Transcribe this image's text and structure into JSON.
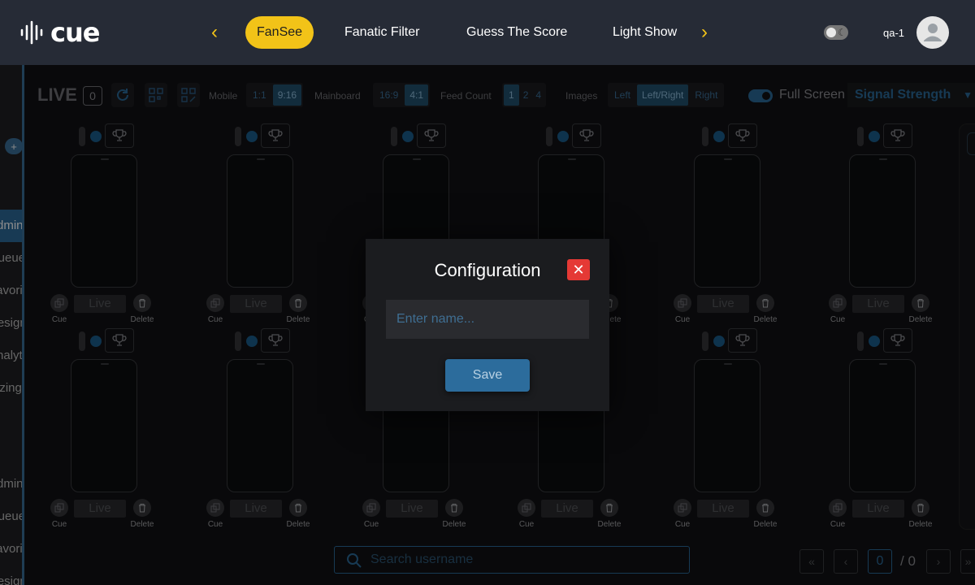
{
  "app": {
    "brand": "cue"
  },
  "nav": {
    "tabs": [
      {
        "label": "FanSee",
        "active": true
      },
      {
        "label": "Fanatic Filter",
        "active": false
      },
      {
        "label": "Guess The Score",
        "active": false
      },
      {
        "label": "Light Show",
        "active": false
      }
    ],
    "user": "qa-1"
  },
  "sidebar": {
    "plus_label": "+",
    "items": [
      {
        "label": "Admin",
        "active": true
      },
      {
        "label": "Queue"
      },
      {
        "label": "Favorites"
      },
      {
        "label": "Design"
      },
      {
        "label": "Analytics"
      },
      {
        "label": "Sizing"
      },
      {
        "label": "Admin"
      },
      {
        "label": "Queue"
      },
      {
        "label": "Favorites"
      },
      {
        "label": "Design"
      }
    ]
  },
  "toolbar": {
    "title": "LIVE",
    "count": "0",
    "mobile_label": "Mobile",
    "mobile_options": [
      {
        "label": "1:1",
        "selected": false
      },
      {
        "label": "9:16",
        "selected": true
      }
    ],
    "mainboard_label": "Mainboard",
    "mainboard_options": [
      {
        "label": "16:9",
        "selected": false
      },
      {
        "label": "4:1",
        "selected": true
      }
    ],
    "feed_count_label": "Feed Count",
    "feed_count_options": [
      {
        "label": "1",
        "selected": true
      },
      {
        "label": "2",
        "selected": false
      },
      {
        "label": "4",
        "selected": false
      }
    ],
    "images_label": "Images",
    "images_options": [
      {
        "label": "Left",
        "selected": false
      },
      {
        "label": "Left/Right",
        "selected": true
      },
      {
        "label": "Right",
        "selected": false
      }
    ],
    "fullscreen_label": "Full Screen",
    "fullscreen_on": true,
    "signal_label": "Signal Strength"
  },
  "feed": {
    "live_label": "Live",
    "cue_label": "Cue",
    "delete_label": "Delete"
  },
  "search": {
    "placeholder": "Search username"
  },
  "pagination": {
    "current": "0",
    "total": "/ 0"
  },
  "modal": {
    "title": "Configuration",
    "name_placeholder": "Enter name...",
    "save_label": "Save"
  },
  "colors": {
    "accent_yellow": "#f2c318",
    "accent_blue": "#2c6c9c",
    "close_red": "#e53935",
    "nav_bg": "#262b36"
  }
}
